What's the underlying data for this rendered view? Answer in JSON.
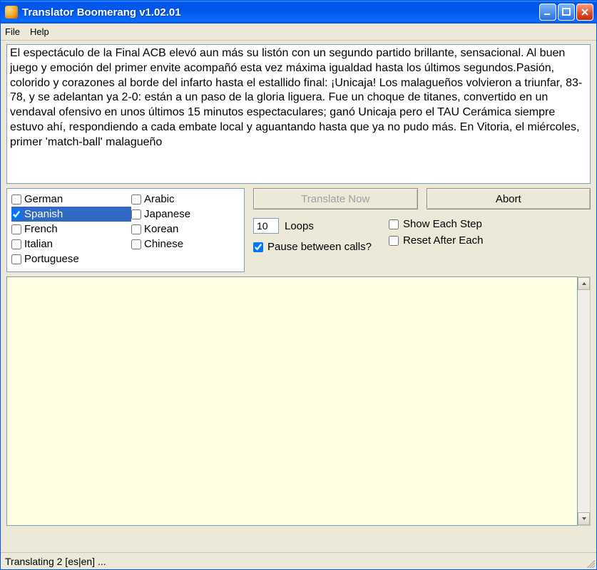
{
  "window": {
    "title": "Translator Boomerang v1.02.01"
  },
  "menu": {
    "file": "File",
    "help": "Help"
  },
  "input": {
    "text": "El espectáculo de la Final ACB elevó aun más su listón con un segundo partido brillante, sensacional. Al buen juego y emoción del primer envite acompañó esta vez máxima igualdad hasta los últimos segundos.Pasión, colorido y corazones al borde del infarto hasta el estallido final: ¡Unicaja! Los malagueños volvieron a triunfar, 83-78, y se adelantan ya 2-0: están a un paso de la gloria liguera. Fue un choque de titanes, convertido en un vendaval ofensivo en unos últimos 15 minutos espectaculares; ganó Unicaja pero el TAU Cerámica siempre estuvo ahí, respondiendo a cada embate local y aguantando hasta que ya no pudo más. En Vitoria, el miércoles, primer 'match-ball' malagueño"
  },
  "languages": {
    "col1": [
      "German",
      "Spanish",
      "French",
      "Italian",
      "Portuguese"
    ],
    "col2": [
      "Arabic",
      "Japanese",
      "Korean",
      "Chinese"
    ],
    "checked": [
      "Spanish"
    ],
    "selected": "Spanish"
  },
  "buttons": {
    "translate": "Translate Now",
    "abort": "Abort"
  },
  "options": {
    "loops_value": "10",
    "loops_label": "Loops",
    "pause_label": "Pause between calls?",
    "pause_checked": true,
    "show_each_label": "Show Each Step",
    "show_each_checked": false,
    "reset_label": "Reset After Each",
    "reset_checked": false
  },
  "output": {
    "text": ""
  },
  "status": {
    "text": "Translating 2 [es|en] ..."
  }
}
